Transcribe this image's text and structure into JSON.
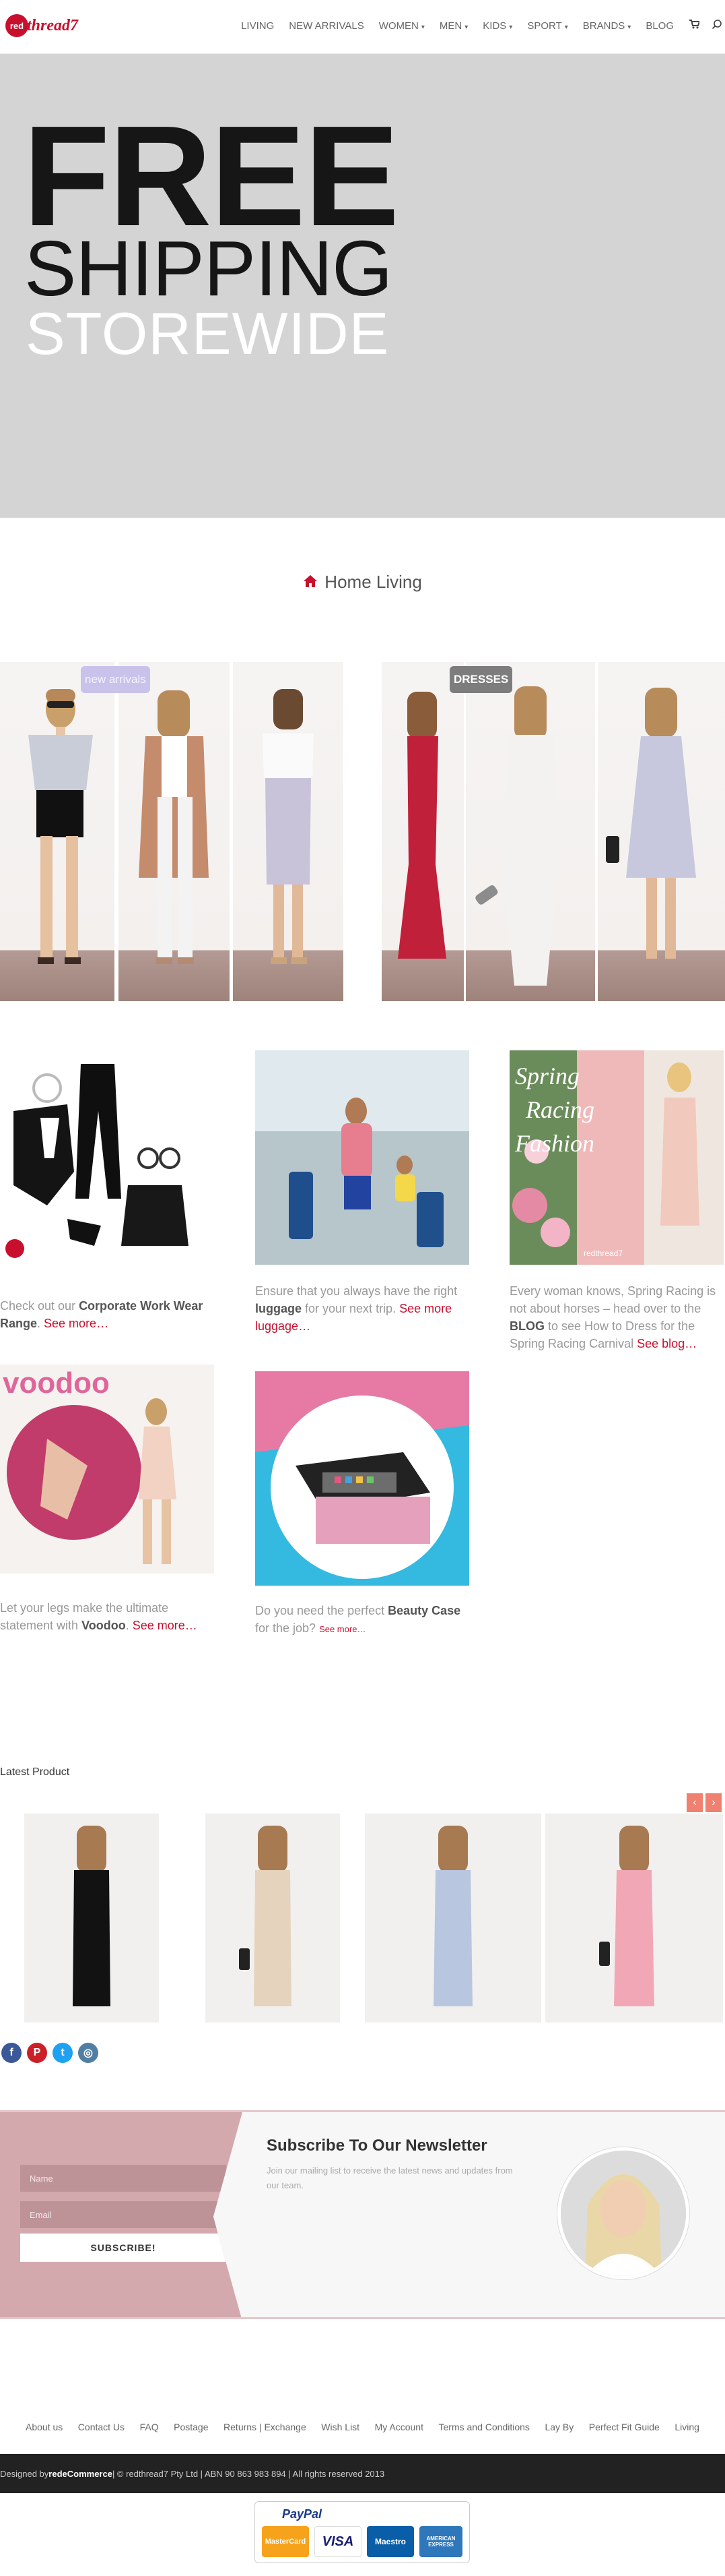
{
  "brand": {
    "logo_red": "red",
    "logo_rest": "thread7",
    "accent": "#c8102e"
  },
  "nav": {
    "items": [
      "LIVING",
      "NEW ARRIVALS",
      "WOMEN",
      "MEN",
      "KIDS",
      "SPORT",
      "BRANDS",
      "BLOG"
    ],
    "dropdown": [
      false,
      false,
      true,
      true,
      true,
      true,
      true,
      false
    ],
    "icons": [
      "cart-icon",
      "search-icon"
    ]
  },
  "hero": {
    "line1": "FREE",
    "line2": "SHIPPING",
    "line3": "STOREWIDE",
    "bg": "#d4d4d4"
  },
  "breadcrumb": {
    "label": "Home Living"
  },
  "lookbook": {
    "badge_left": "new arrivals",
    "badge_right": "DRESSES"
  },
  "blog": [
    {
      "prefix": "Check out our ",
      "bold": "Corporate Work Wear Range",
      "suffix": ". ",
      "more": "See more…"
    },
    {
      "prefix": "Ensure that you always have the right ",
      "bold": "luggage",
      "suffix": " for your next trip. ",
      "more": "See more luggage…"
    },
    {
      "prefix": "Every woman knows, Spring Racing is not about horses – head over to the ",
      "bold": "BLOG",
      "suffix": " to see How to Dress for the Spring Racing Carnival ",
      "more": "See blog…"
    },
    {
      "prefix": "Let your legs make the ultimate statement with ",
      "bold": "Voodoo",
      "suffix": ". ",
      "more": "See more…"
    },
    {
      "prefix": "Do you need the perfect ",
      "bold": "Beauty Case",
      "suffix": " for the job? ",
      "more": "See more…"
    }
  ],
  "blog_images": {
    "spring_text": "Spring Racing Fashion",
    "voodoo_text": "voodoo"
  },
  "latest": {
    "title": "Latest Product",
    "prev": "‹",
    "next": "›"
  },
  "social": [
    "f",
    "P",
    "t",
    "◎"
  ],
  "newsletter": {
    "name_placeholder": "Name",
    "email_placeholder": "Email",
    "button": "SUBSCRIBE!",
    "title": "Subscribe To Our Newsletter",
    "subtitle": "Join our mailing list to receive the latest news and updates from our team."
  },
  "footer": {
    "links": [
      "About us",
      "Contact Us",
      "FAQ",
      "Postage",
      "Returns | Exchange",
      "Wish List",
      "My Account",
      "Terms and Conditions",
      "Lay By",
      "Perfect Fit Guide",
      "Living"
    ],
    "designed_by": "Designed by ",
    "designer": "redeCommerce",
    "copyright": " | © redthread7 Pty Ltd | ABN 90 863 983 894 | All rights reserved 2013",
    "payments": [
      "PayPal",
      "MasterCard",
      "VISA",
      "Maestro",
      "AMERICAN EXPRESS"
    ]
  }
}
